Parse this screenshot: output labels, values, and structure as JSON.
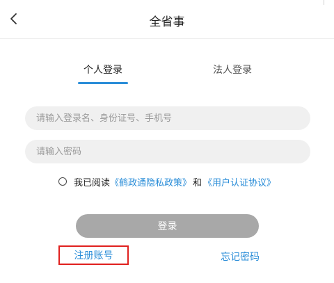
{
  "header": {
    "title": "全省事",
    "back_icon": "chevron-left-icon"
  },
  "tabs": [
    {
      "label": "个人登录",
      "active": true
    },
    {
      "label": "法人登录",
      "active": false
    }
  ],
  "form": {
    "account_placeholder": "请输入登录名、身份证号、手机号",
    "account_value": "",
    "password_placeholder": "请输入密码",
    "password_value": ""
  },
  "agreement": {
    "checked": false,
    "prefix": "我已阅读",
    "privacy_link": "《鹤政通隐私政策》",
    "and_text": "和",
    "auth_link": "《用户认证协议》"
  },
  "actions": {
    "login_label": "登录",
    "register_label": "注册账号",
    "forgot_label": "忘记密码"
  },
  "colors": {
    "accent": "#2a8dd8",
    "button_disabled": "#a8a8a8",
    "highlight_box": "#e0201e",
    "input_bg": "#f0f0f0"
  }
}
